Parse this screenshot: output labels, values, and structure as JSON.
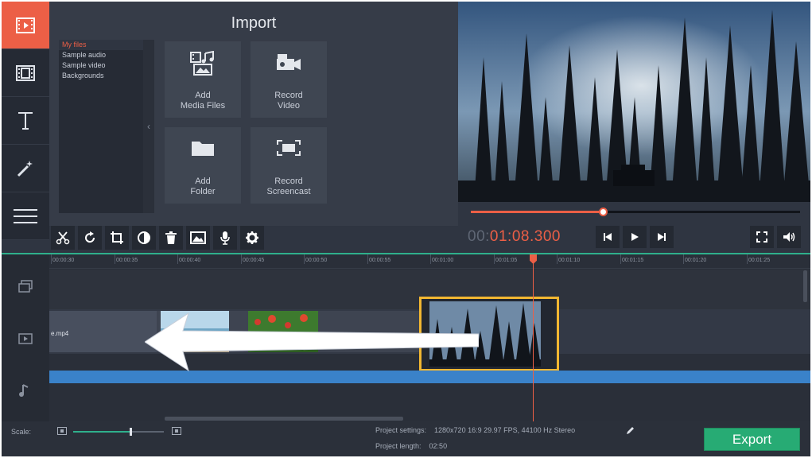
{
  "sidebar": {
    "items": [
      {
        "icon": "import-film-icon",
        "active": true
      },
      {
        "icon": "filters-icon",
        "active": false
      },
      {
        "icon": "titles-icon",
        "active": false
      },
      {
        "icon": "effects-wand-icon",
        "active": false
      },
      {
        "icon": "menu-icon",
        "active": false
      }
    ]
  },
  "import": {
    "title": "Import",
    "file_list": [
      "My files",
      "Sample audio",
      "Sample video",
      "Backgrounds"
    ],
    "collapse_glyph": "‹",
    "tiles": [
      {
        "label": "Add\nMedia Files",
        "icon": "media-files-icon"
      },
      {
        "label": "Record\nVideo",
        "icon": "record-video-icon"
      },
      {
        "label": "Add\nFolder",
        "icon": "folder-icon"
      },
      {
        "label": "Record\nScreencast",
        "icon": "screencast-icon"
      }
    ]
  },
  "player": {
    "timecode_dim": "00:",
    "timecode_hi": "01:08.300",
    "progress": 0.4
  },
  "timeline": {
    "ruler_ticks": [
      "00:00:30",
      "00:00:35",
      "00:00:40",
      "00:00:45",
      "00:00:50",
      "00:00:55",
      "00:01:00",
      "00:01:05",
      "00:01:10",
      "00:01:15",
      "00:01:20",
      "00:01:25"
    ],
    "clip_name": "e.mp4"
  },
  "status": {
    "scale_label": "Scale:",
    "scale_value": 0.63,
    "project_settings_label": "Project settings:",
    "project_settings_value": "1280x720 16:9 29.97 FPS, 44100 Hz Stereo",
    "project_length_label": "Project length:",
    "project_length_value": "02:50",
    "export_label": "Export"
  },
  "colors": {
    "accent": "#ec5f46",
    "export": "#27ab74",
    "selection": "#f2b731",
    "audio": "#3a82c9"
  }
}
